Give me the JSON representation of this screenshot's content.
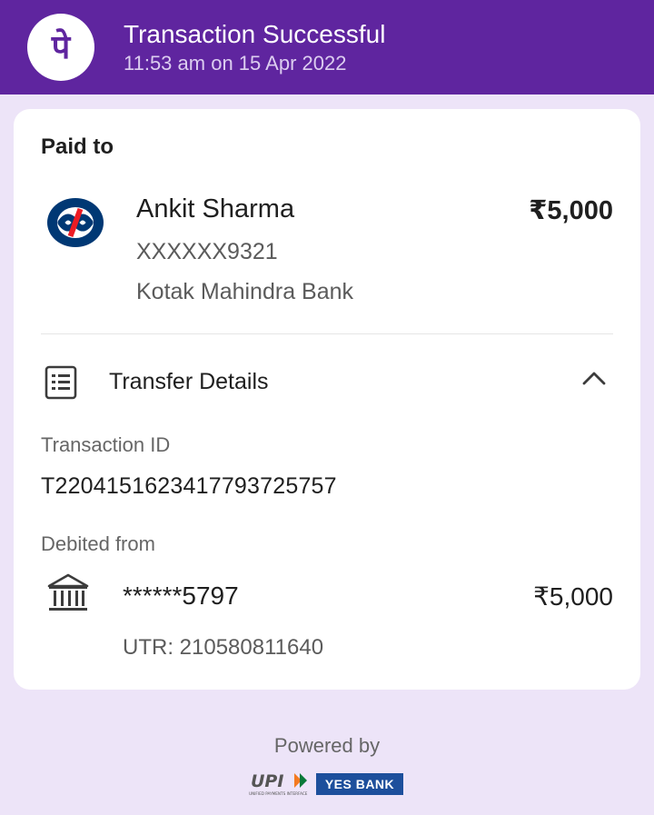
{
  "header": {
    "title": "Transaction Successful",
    "subtitle": "11:53 am on 15 Apr 2022",
    "logo_text": "पे",
    "color": "#5f259f"
  },
  "payee": {
    "section_label": "Paid to",
    "name": "Ankit Sharma",
    "amount": "₹5,000",
    "account": "XXXXXX9321",
    "bank": "Kotak Mahindra Bank",
    "bank_icon": "kotak-bank-logo"
  },
  "transfer_details": {
    "label": "Transfer Details",
    "icon": "receipt-icon",
    "expanded_icon": "chevron-up-icon",
    "transaction_id_label": "Transaction ID",
    "transaction_id": "T2204151623417793725757",
    "debited_label": "Debited from",
    "debited_account": "******5797",
    "debited_amount": "₹5,000",
    "utr": "UTR: 210580811640",
    "bank_icon": "bank-icon"
  },
  "footer": {
    "powered_by": "Powered by",
    "upi_logo_text": "UPI",
    "upi_tagline": "UNIFIED PAYMENTS INTERFACE",
    "partner_bank": "YES BANK"
  }
}
